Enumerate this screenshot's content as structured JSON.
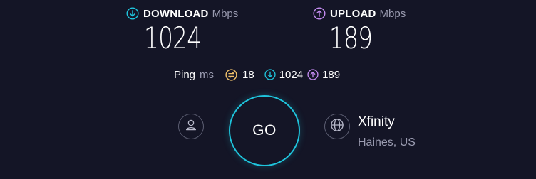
{
  "download": {
    "label": "DOWNLOAD",
    "unit": "Mbps",
    "value": "1024",
    "icon": "download-arrow-icon",
    "color": "#1fc5dd"
  },
  "upload": {
    "label": "UPLOAD",
    "unit": "Mbps",
    "value": "189",
    "icon": "upload-arrow-icon",
    "color": "#c58cf2"
  },
  "ping": {
    "label": "Ping",
    "unit": "ms",
    "idle_value": "18",
    "idle_icon": "ping-latency-icon",
    "idle_color": "#f0c06a",
    "download_value": "1024",
    "upload_value": "189"
  },
  "go_button": {
    "label": "GO",
    "color": "#1fc5dd"
  },
  "account": {
    "icon": "user-icon"
  },
  "server": {
    "icon": "globe-icon",
    "isp": "Xfinity",
    "location": "Haines, US"
  }
}
